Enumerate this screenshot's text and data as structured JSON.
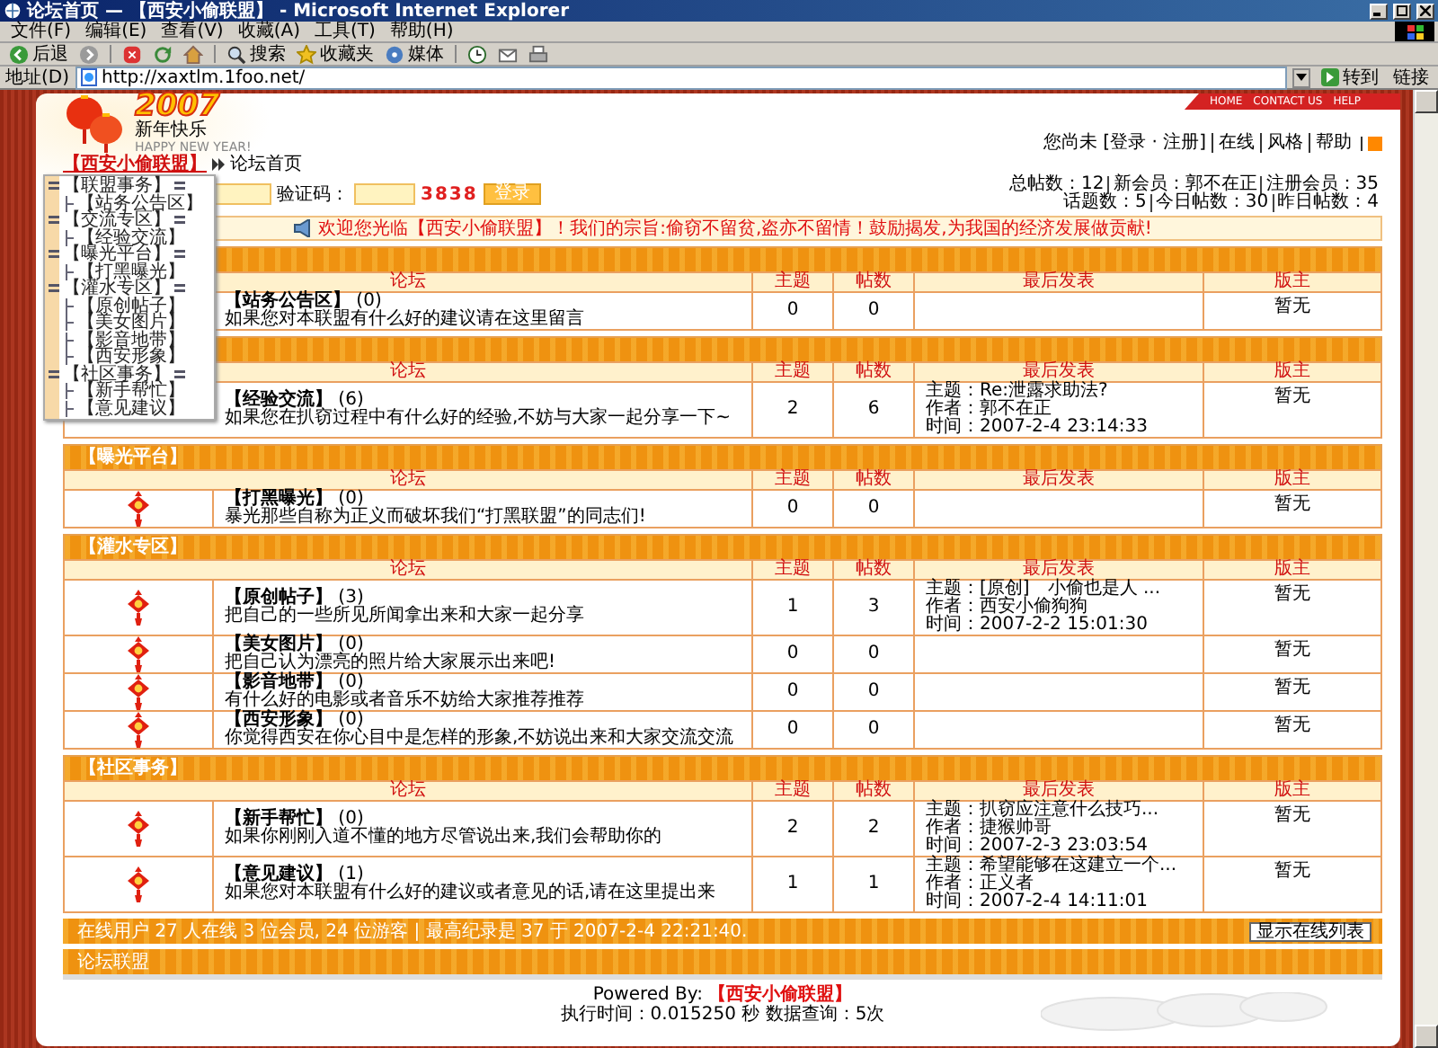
{
  "window": {
    "title": "论坛首页 — 【西安小偷联盟】 - Microsoft Internet Explorer"
  },
  "menu": [
    "文件(F)",
    "编辑(E)",
    "查看(V)",
    "收藏(A)",
    "工具(T)",
    "帮助(H)"
  ],
  "toolbar": [
    {
      "kind": "back",
      "label": "后退"
    },
    {
      "kind": "forward"
    },
    {
      "kind": "stop"
    },
    {
      "kind": "refresh"
    },
    {
      "kind": "home"
    },
    {
      "kind": "search",
      "label": "搜索"
    },
    {
      "kind": "favorites",
      "label": "收藏夹"
    },
    {
      "kind": "media",
      "label": "媒体"
    },
    {
      "kind": "history"
    },
    {
      "kind": "mail"
    },
    {
      "kind": "print"
    }
  ],
  "address": {
    "label": "地址(D)",
    "value": "http://xaxtlm.1foo.net/",
    "go": "转到",
    "links": "链接"
  },
  "site": {
    "logo_year": "2007",
    "logo_title": "新年快乐",
    "logo_subtitle": "HAPPY NEW YEAR!",
    "nav": [
      "HOME",
      "CONTACT US",
      "HELP"
    ],
    "user_prefix": "您尚未",
    "user_links": [
      "[登录 · 注册]",
      "在线",
      "风格",
      "帮助"
    ]
  },
  "breadcrumb": {
    "home": "【西安小偷联盟】",
    "current": "论坛首页"
  },
  "dropdown": [
    {
      "label": "【联盟事务】",
      "children": [
        {
          "label": "【站务公告区】"
        }
      ]
    },
    {
      "label": "【交流专区】",
      "children": [
        {
          "label": "【经验交流】"
        }
      ]
    },
    {
      "label": "【曝光平台】",
      "children": [
        {
          "label": "【打黑曝光】"
        }
      ]
    },
    {
      "label": "【灌水专区】",
      "children": [
        {
          "label": "【原创帖子】"
        },
        {
          "label": "【美女图片】"
        },
        {
          "label": "【影音地带】"
        },
        {
          "label": "【西安形象】"
        }
      ]
    },
    {
      "label": "【社区事务】",
      "children": [
        {
          "label": "【新手帮忙】"
        },
        {
          "label": "【意见建议】"
        }
      ]
    }
  ],
  "login": {
    "code_label": "验证码：",
    "code": "3838",
    "button": "登录"
  },
  "stats": [
    [
      "总帖数：12",
      "新会员：郭不在正",
      "注册会员：35"
    ],
    [
      "话题数：5",
      "今日帖数：30",
      "昨日帖数：4"
    ]
  ],
  "notice": "欢迎您光临【西安小偷联盟】！我们的宗旨:偷窃不留贫,盗亦不留情！鼓励揭发,为我国的经济发展做贡献!",
  "sections": [
    {
      "columns": [
        "论坛",
        "主题",
        "帖数",
        "最后发表",
        "版主"
      ],
      "forums": [
        {
          "name": "【站务公告区】",
          "icon": false,
          "count": "(0)",
          "description": "如果您对本联盟有什么好的建议请在这里留言",
          "topics": "0",
          "posts": "0",
          "moderator": "暂无"
        }
      ]
    },
    {
      "columns": [
        "论坛",
        "主题",
        "帖数",
        "最后发表",
        "版主"
      ],
      "forums": [
        {
          "name": "【经验交流】",
          "icon": false,
          "count": "(6)",
          "description": "如果您在扒窃过程中有什么好的经验,不妨与大家一起分享一下~",
          "topics": "2",
          "posts": "6",
          "last_post": {
            "topic": "主题：Re:泄露求助法?",
            "author": "作者：郭不在正",
            "time": "时间：2007-2-4 23:14:33"
          },
          "moderator": "暂无"
        }
      ]
    },
    {
      "title": "【曝光平台】",
      "columns": [
        "论坛",
        "主题",
        "帖数",
        "最后发表",
        "版主"
      ],
      "forums": [
        {
          "name": "【打黑曝光】",
          "icon": true,
          "count": "(0)",
          "description": "暴光那些自称为正义而破坏我们“打黑联盟”的同志们!",
          "topics": "0",
          "posts": "0",
          "moderator": "暂无"
        }
      ]
    },
    {
      "title": "【灌水专区】",
      "columns": [
        "论坛",
        "主题",
        "帖数",
        "最后发表",
        "版主"
      ],
      "forums": [
        {
          "name": "【原创帖子】",
          "icon": true,
          "count": "(3)",
          "description": "把自己的一些所见所闻拿出来和大家一起分享",
          "topics": "1",
          "posts": "3",
          "last_post": {
            "topic": "主题：[原创]　小偷也是人 ...",
            "author": "作者：西安小偷狗狗",
            "time": "时间：2007-2-2 15:01:30"
          },
          "moderator": "暂无"
        },
        {
          "name": "【美女图片】",
          "icon": true,
          "count": "(0)",
          "description": "把自己认为漂亮的照片给大家展示出来吧!",
          "topics": "0",
          "posts": "0",
          "moderator": "暂无"
        },
        {
          "name": "【影音地带】",
          "icon": true,
          "count": "(0)",
          "description": "有什么好的电影或者音乐不妨给大家推荐推荐",
          "topics": "0",
          "posts": "0",
          "moderator": "暂无"
        },
        {
          "name": "【西安形象】",
          "icon": true,
          "count": "(0)",
          "description": "你觉得西安在你心目中是怎样的形象,不妨说出来和大家交流交流",
          "topics": "0",
          "posts": "0",
          "moderator": "暂无"
        }
      ]
    },
    {
      "title": "【社区事务】",
      "columns": [
        "论坛",
        "主题",
        "帖数",
        "最后发表",
        "版主"
      ],
      "forums": [
        {
          "name": "【新手帮忙】",
          "icon": true,
          "count": "(0)",
          "description": "如果你刚刚入道不懂的地方尽管说出来,我们会帮助你的",
          "topics": "2",
          "posts": "2",
          "last_post": {
            "topic": "主题：扒窃应注意什么技巧...",
            "author": "作者：捷猴帅哥",
            "time": "时间：2007-2-3 23:03:54"
          },
          "moderator": "暂无"
        },
        {
          "name": "【意见建议】",
          "icon": true,
          "count": "(1)",
          "description": "如果您对本联盟有什么好的建议或者意见的话,请在这里提出来",
          "topics": "1",
          "posts": "1",
          "last_post": {
            "topic": "主题：希望能够在这建立一个...",
            "author": "作者：正义者",
            "time": "时间：2007-2-4 14:11:01"
          },
          "moderator": "暂无"
        }
      ]
    }
  ],
  "online": {
    "text": "在线用户 27 人在线 3 位会员, 24 位游客 | 最高纪录是 37 于 2007-2-4 22:21:40.",
    "button": "显示在线列表"
  },
  "links_bar": {
    "title": "论坛联盟"
  },
  "footer": {
    "powered": "Powered By:",
    "brand": "【西安小偷联盟】",
    "stats": "执行时间：0.015250 秒 数据查询：5次"
  }
}
